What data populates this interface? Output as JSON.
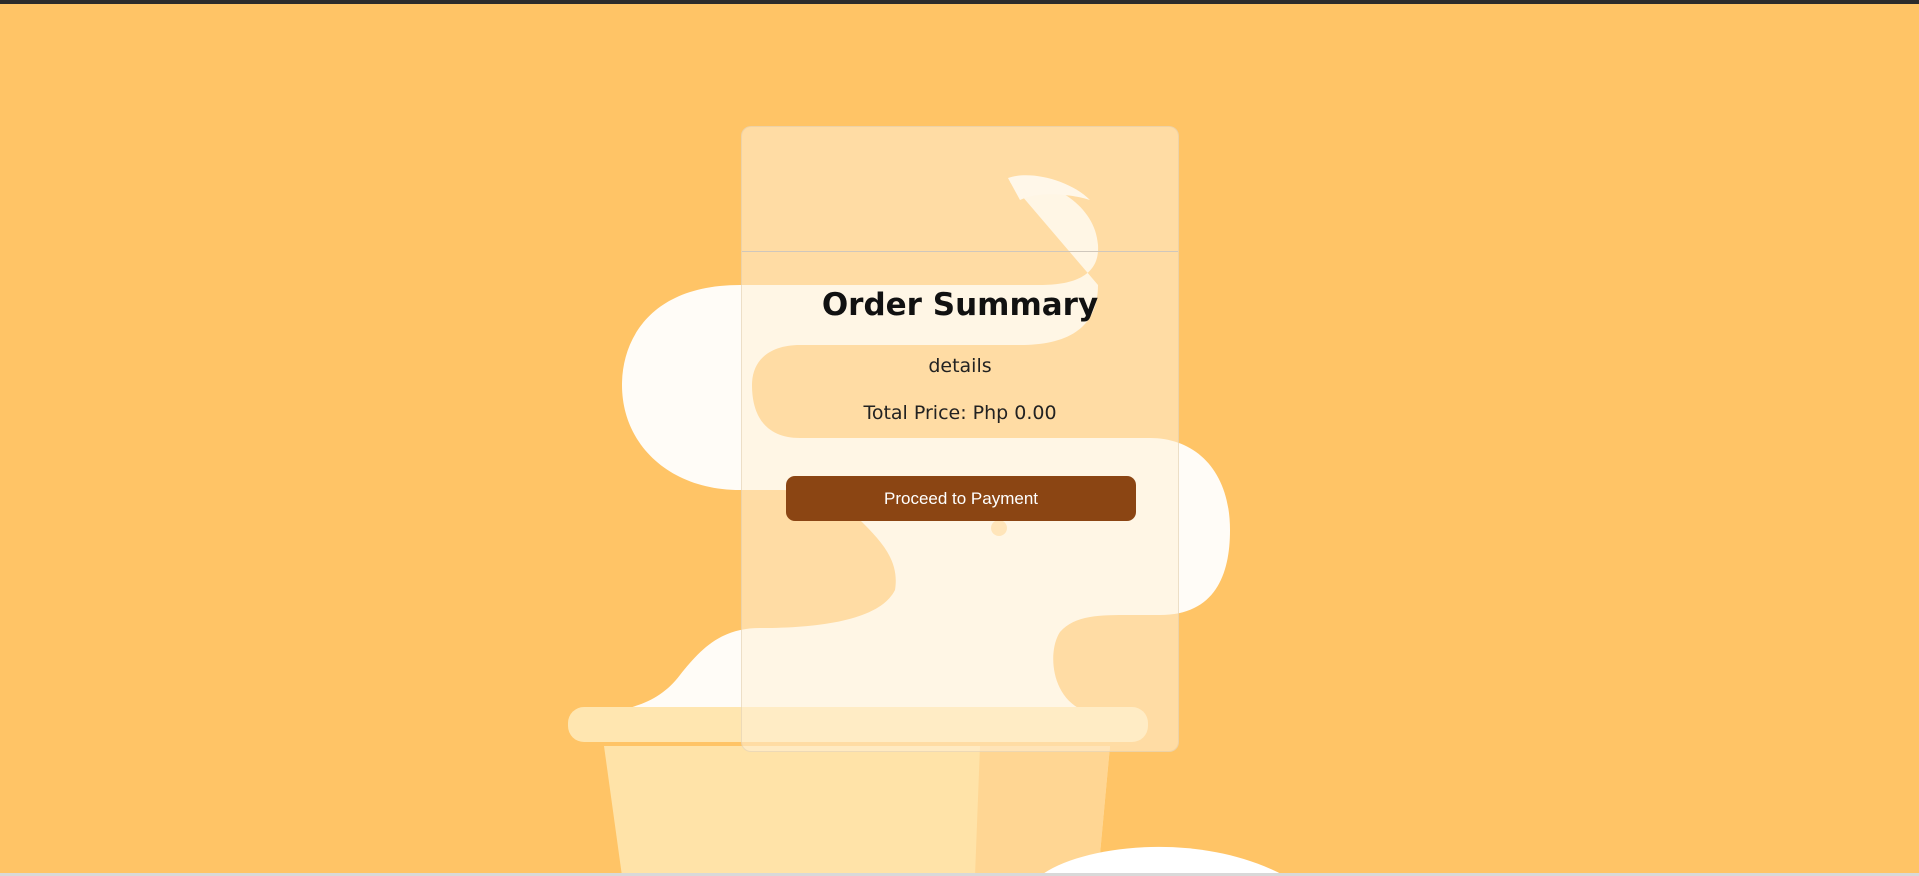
{
  "order_summary": {
    "title": "Order Summary",
    "details_text": "details",
    "total_label": "Total Price:",
    "total_value": "Php 0.00",
    "proceed_button_label": "Proceed to Payment"
  },
  "colors": {
    "background": "#ffc466",
    "button": "#8b4513",
    "card_tint": "#fff0d7",
    "steam": "#ffffff"
  }
}
